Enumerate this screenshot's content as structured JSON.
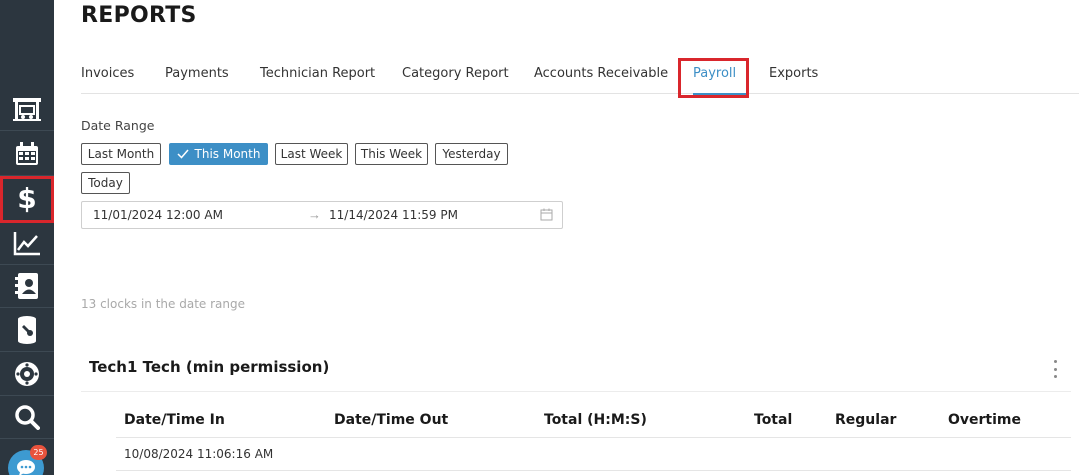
{
  "page": {
    "title": "REPORTS"
  },
  "sidebar": {
    "items": [
      {
        "icon": "shop-icon",
        "active": false
      },
      {
        "icon": "calendar-icon",
        "active": false
      },
      {
        "icon": "dollar-icon",
        "label": "$",
        "active": true
      },
      {
        "icon": "chart-icon",
        "active": false
      },
      {
        "icon": "contacts-icon",
        "active": false
      },
      {
        "icon": "parts-icon",
        "active": false
      },
      {
        "icon": "tire-icon",
        "active": false
      },
      {
        "icon": "search-icon",
        "active": false
      }
    ],
    "chat": {
      "icon": "chat-icon",
      "badge": "25"
    },
    "active_color": "#d9262c",
    "background": "#2c363f"
  },
  "tabs": {
    "items": [
      "Invoices",
      "Payments",
      "Technician Report",
      "Category Report",
      "Accounts Receivable",
      "Payroll",
      "Exports"
    ],
    "active": "Payroll",
    "accent_color": "#3d8fc6"
  },
  "date_range": {
    "label": "Date Range",
    "presets": [
      "Last Month",
      "This Month",
      "Last Week",
      "This Week",
      "Yesterday",
      "Today"
    ],
    "selected": "This Month",
    "start": "11/01/2024 12:00 AM",
    "end": "11/14/2024 11:59 PM",
    "arrow": "→"
  },
  "summary": {
    "clock_count": "13 clocks in the date range"
  },
  "section": {
    "title": "Tech1 Tech (min permission)",
    "columns": [
      "Date/Time In",
      "Date/Time Out",
      "Total (H:M:S)",
      "Total",
      "Regular",
      "Overtime"
    ],
    "rows": [
      [
        "10/08/2024 11:06:16 AM",
        "",
        "",
        "",
        "",
        ""
      ]
    ]
  }
}
